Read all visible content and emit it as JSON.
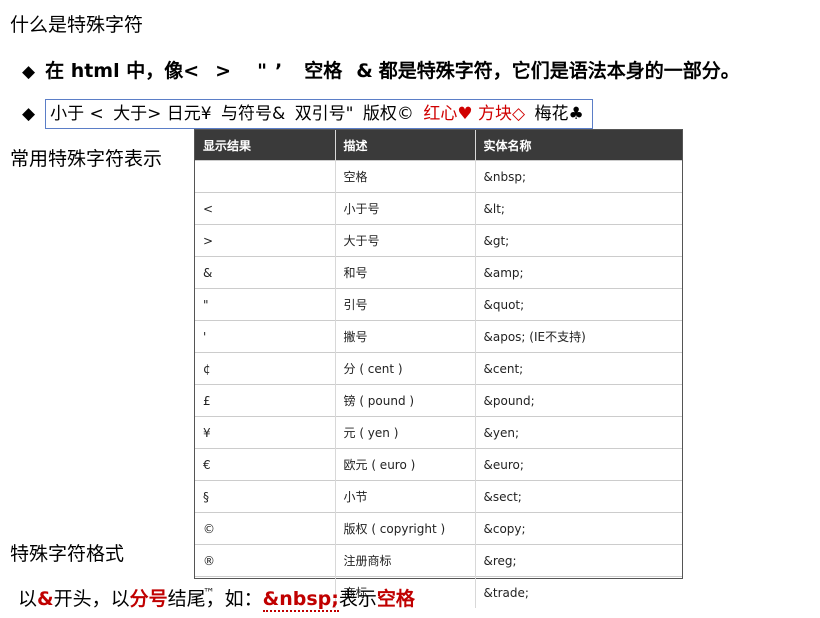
{
  "title": "什么是特殊字符",
  "bullet1": {
    "marker": "◆",
    "parts": [
      "在 html 中，像<",
      ">",
      "\"",
      "’",
      "空格",
      "&",
      "都是特殊字符，它们是语法本身的一部分。"
    ]
  },
  "bullet2": {
    "marker": "◆",
    "items": [
      {
        "text": "小于 <",
        "red": false
      },
      {
        "text": "大于> 日元¥",
        "red": false
      },
      {
        "text": "与符号&",
        "red": false
      },
      {
        "text": "双引号\"",
        "red": false
      },
      {
        "text": "版权©",
        "red": false
      },
      {
        "text": "红心♥ 方块◇",
        "red": true
      },
      {
        "text": "梅花♣",
        "red": false
      }
    ]
  },
  "subtitle_common": "常用特殊字符表示",
  "table": {
    "headers": [
      "显示结果",
      "描述",
      "实体名称"
    ],
    "rows": [
      [
        "",
        "空格",
        "&nbsp;"
      ],
      [
        "<",
        "小于号",
        "&lt;"
      ],
      [
        ">",
        "大于号",
        "&gt;"
      ],
      [
        "&",
        "和号",
        "&amp;"
      ],
      [
        "\"",
        "引号",
        "&quot;"
      ],
      [
        "'",
        "撇号",
        "&apos; (IE不支持)"
      ],
      [
        "¢",
        "分 ( cent )",
        "&cent;"
      ],
      [
        "£",
        "镑 ( pound )",
        "&pound;"
      ],
      [
        "¥",
        "元 ( yen )",
        "&yen;"
      ],
      [
        "€",
        "欧元 ( euro )",
        "&euro;"
      ],
      [
        "§",
        "小节",
        "&sect;"
      ],
      [
        "©",
        "版权 ( copyright )",
        "&copy;"
      ],
      [
        "®",
        "注册商标",
        "&reg;"
      ],
      [
        "™",
        "商标",
        "&trade;"
      ]
    ]
  },
  "subtitle_format": "特殊字符格式",
  "final": {
    "p1": "以",
    "amp": "&",
    "p2": "开头，以",
    "semi": "分号",
    "p3": "结尾，如：",
    "code": "&nbsp;",
    "p4": "表示",
    "space": "空格"
  }
}
